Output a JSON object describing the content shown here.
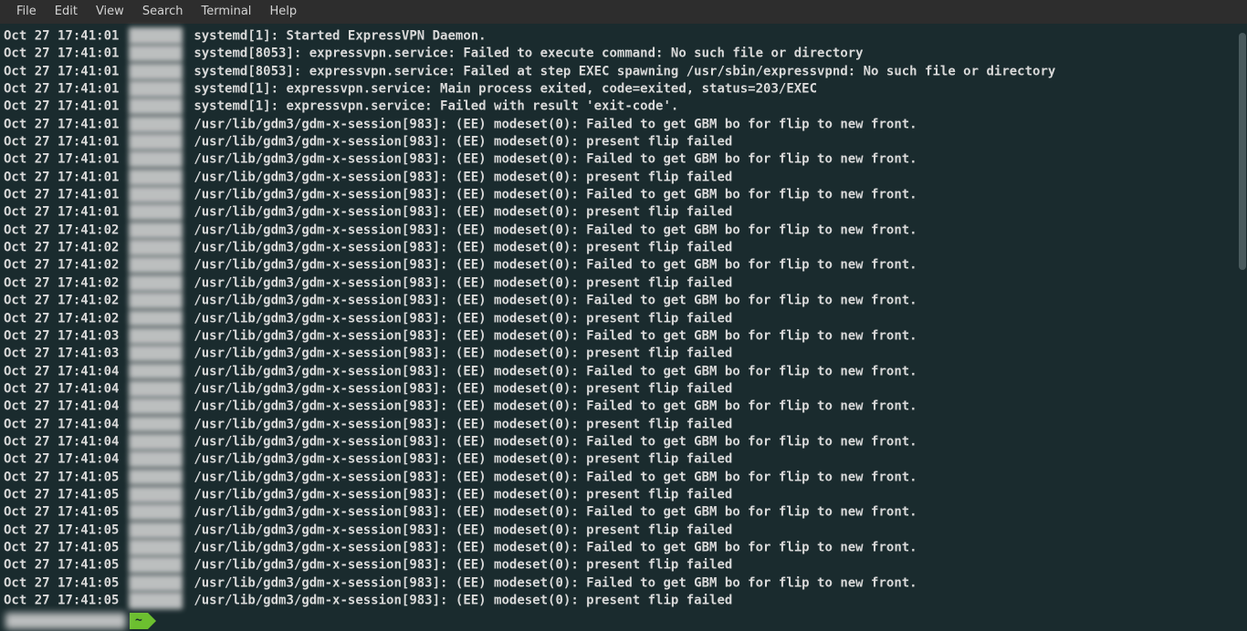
{
  "menubar": {
    "items": [
      "File",
      "Edit",
      "View",
      "Search",
      "Terminal",
      "Help"
    ]
  },
  "prompt": {
    "tilde": "~"
  },
  "log_lines": [
    {
      "ts": "Oct 27 17:41:01",
      "msg": "systemd[1]: Started ExpressVPN Daemon."
    },
    {
      "ts": "Oct 27 17:41:01",
      "msg": "systemd[8053]: expressvpn.service: Failed to execute command: No such file or directory"
    },
    {
      "ts": "Oct 27 17:41:01",
      "msg": "systemd[8053]: expressvpn.service: Failed at step EXEC spawning /usr/sbin/expressvpnd: No such file or directory"
    },
    {
      "ts": "Oct 27 17:41:01",
      "msg": "systemd[1]: expressvpn.service: Main process exited, code=exited, status=203/EXEC"
    },
    {
      "ts": "Oct 27 17:41:01",
      "msg": "systemd[1]: expressvpn.service: Failed with result 'exit-code'."
    },
    {
      "ts": "Oct 27 17:41:01",
      "msg": "/usr/lib/gdm3/gdm-x-session[983]: (EE) modeset(0): Failed to get GBM bo for flip to new front."
    },
    {
      "ts": "Oct 27 17:41:01",
      "msg": "/usr/lib/gdm3/gdm-x-session[983]: (EE) modeset(0): present flip failed"
    },
    {
      "ts": "Oct 27 17:41:01",
      "msg": "/usr/lib/gdm3/gdm-x-session[983]: (EE) modeset(0): Failed to get GBM bo for flip to new front."
    },
    {
      "ts": "Oct 27 17:41:01",
      "msg": "/usr/lib/gdm3/gdm-x-session[983]: (EE) modeset(0): present flip failed"
    },
    {
      "ts": "Oct 27 17:41:01",
      "msg": "/usr/lib/gdm3/gdm-x-session[983]: (EE) modeset(0): Failed to get GBM bo for flip to new front."
    },
    {
      "ts": "Oct 27 17:41:01",
      "msg": "/usr/lib/gdm3/gdm-x-session[983]: (EE) modeset(0): present flip failed"
    },
    {
      "ts": "Oct 27 17:41:02",
      "msg": "/usr/lib/gdm3/gdm-x-session[983]: (EE) modeset(0): Failed to get GBM bo for flip to new front."
    },
    {
      "ts": "Oct 27 17:41:02",
      "msg": "/usr/lib/gdm3/gdm-x-session[983]: (EE) modeset(0): present flip failed"
    },
    {
      "ts": "Oct 27 17:41:02",
      "msg": "/usr/lib/gdm3/gdm-x-session[983]: (EE) modeset(0): Failed to get GBM bo for flip to new front."
    },
    {
      "ts": "Oct 27 17:41:02",
      "msg": "/usr/lib/gdm3/gdm-x-session[983]: (EE) modeset(0): present flip failed"
    },
    {
      "ts": "Oct 27 17:41:02",
      "msg": "/usr/lib/gdm3/gdm-x-session[983]: (EE) modeset(0): Failed to get GBM bo for flip to new front."
    },
    {
      "ts": "Oct 27 17:41:02",
      "msg": "/usr/lib/gdm3/gdm-x-session[983]: (EE) modeset(0): present flip failed"
    },
    {
      "ts": "Oct 27 17:41:03",
      "msg": "/usr/lib/gdm3/gdm-x-session[983]: (EE) modeset(0): Failed to get GBM bo for flip to new front."
    },
    {
      "ts": "Oct 27 17:41:03",
      "msg": "/usr/lib/gdm3/gdm-x-session[983]: (EE) modeset(0): present flip failed"
    },
    {
      "ts": "Oct 27 17:41:04",
      "msg": "/usr/lib/gdm3/gdm-x-session[983]: (EE) modeset(0): Failed to get GBM bo for flip to new front."
    },
    {
      "ts": "Oct 27 17:41:04",
      "msg": "/usr/lib/gdm3/gdm-x-session[983]: (EE) modeset(0): present flip failed"
    },
    {
      "ts": "Oct 27 17:41:04",
      "msg": "/usr/lib/gdm3/gdm-x-session[983]: (EE) modeset(0): Failed to get GBM bo for flip to new front."
    },
    {
      "ts": "Oct 27 17:41:04",
      "msg": "/usr/lib/gdm3/gdm-x-session[983]: (EE) modeset(0): present flip failed"
    },
    {
      "ts": "Oct 27 17:41:04",
      "msg": "/usr/lib/gdm3/gdm-x-session[983]: (EE) modeset(0): Failed to get GBM bo for flip to new front."
    },
    {
      "ts": "Oct 27 17:41:04",
      "msg": "/usr/lib/gdm3/gdm-x-session[983]: (EE) modeset(0): present flip failed"
    },
    {
      "ts": "Oct 27 17:41:05",
      "msg": "/usr/lib/gdm3/gdm-x-session[983]: (EE) modeset(0): Failed to get GBM bo for flip to new front."
    },
    {
      "ts": "Oct 27 17:41:05",
      "msg": "/usr/lib/gdm3/gdm-x-session[983]: (EE) modeset(0): present flip failed"
    },
    {
      "ts": "Oct 27 17:41:05",
      "msg": "/usr/lib/gdm3/gdm-x-session[983]: (EE) modeset(0): Failed to get GBM bo for flip to new front."
    },
    {
      "ts": "Oct 27 17:41:05",
      "msg": "/usr/lib/gdm3/gdm-x-session[983]: (EE) modeset(0): present flip failed"
    },
    {
      "ts": "Oct 27 17:41:05",
      "msg": "/usr/lib/gdm3/gdm-x-session[983]: (EE) modeset(0): Failed to get GBM bo for flip to new front."
    },
    {
      "ts": "Oct 27 17:41:05",
      "msg": "/usr/lib/gdm3/gdm-x-session[983]: (EE) modeset(0): present flip failed"
    },
    {
      "ts": "Oct 27 17:41:05",
      "msg": "/usr/lib/gdm3/gdm-x-session[983]: (EE) modeset(0): Failed to get GBM bo for flip to new front."
    },
    {
      "ts": "Oct 27 17:41:05",
      "msg": "/usr/lib/gdm3/gdm-x-session[983]: (EE) modeset(0): present flip failed"
    }
  ]
}
